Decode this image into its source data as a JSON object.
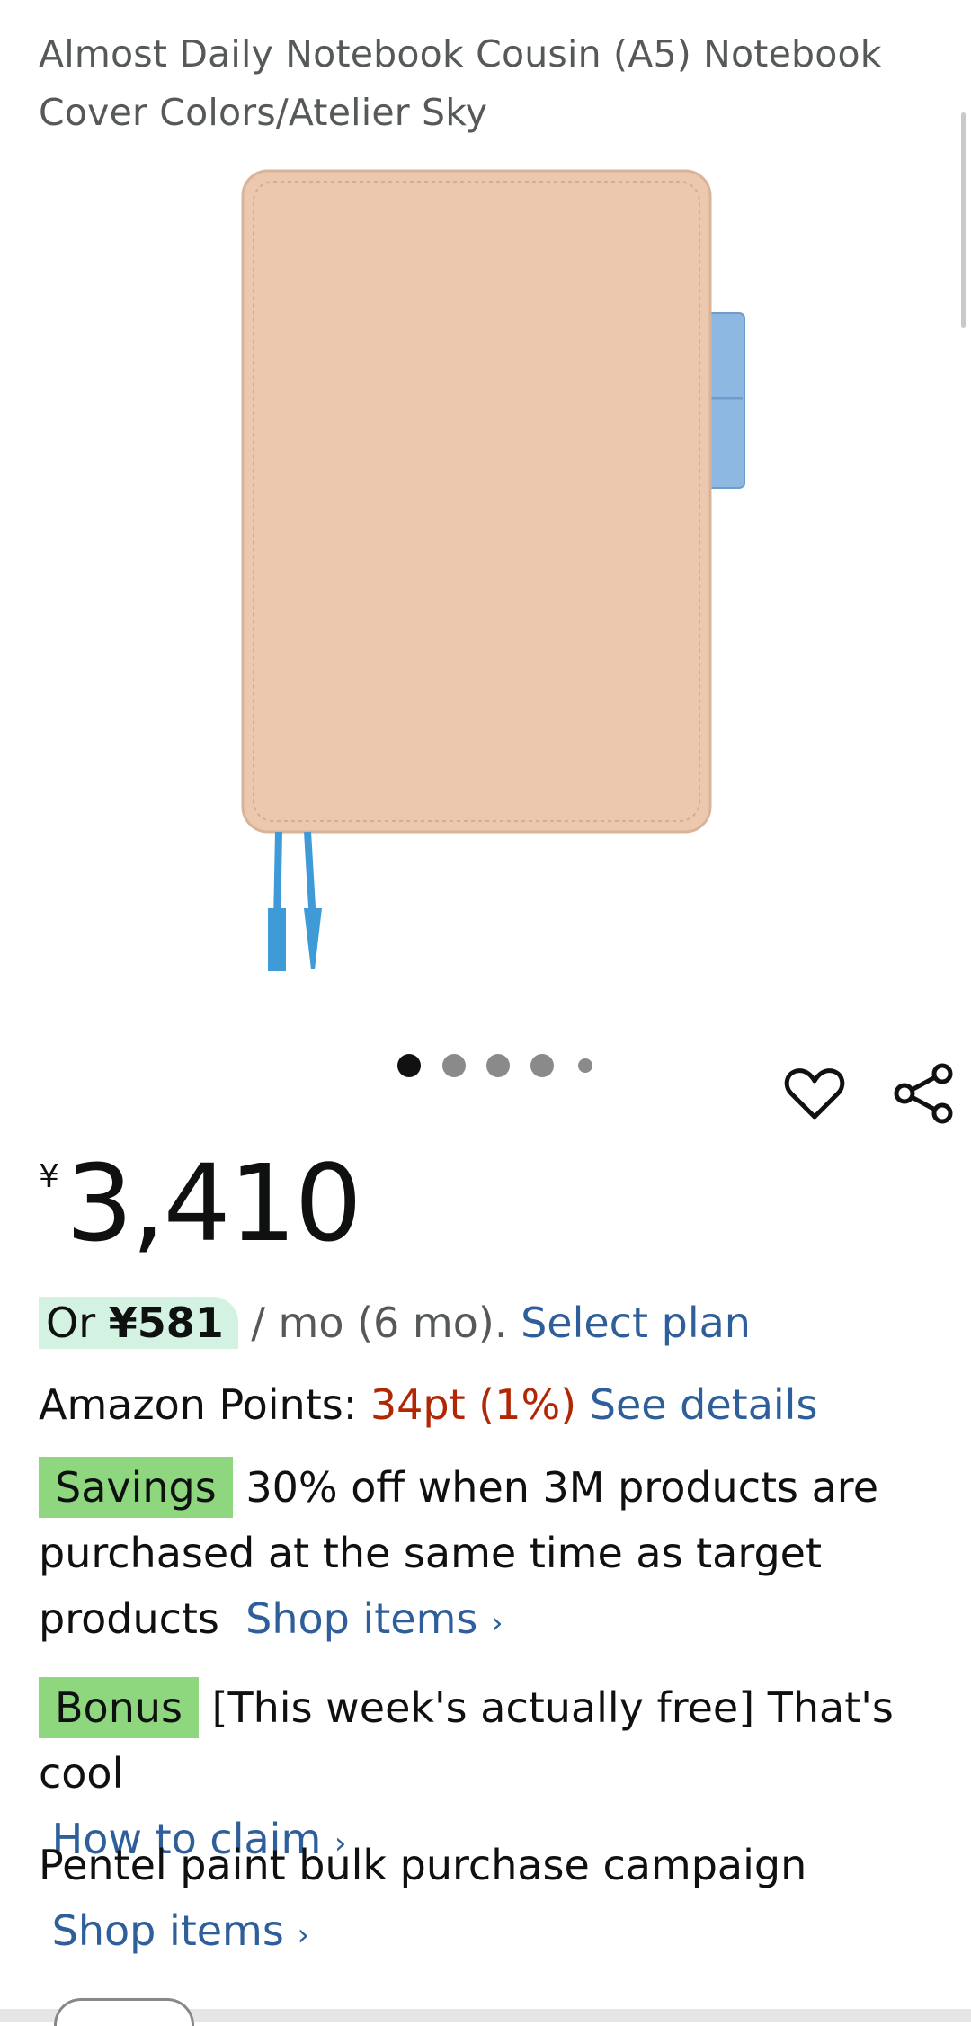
{
  "product": {
    "title": "Almost Daily Notebook Cousin (A5) Notebook Cover Colors/Atelier Sky",
    "colors": {
      "cover": "#ecc8ae",
      "accent_tab": "#8cb8e2",
      "bookmark": "#3f9ad8"
    }
  },
  "carousel": {
    "total": 5,
    "active_index": 0
  },
  "price": {
    "currency": "¥",
    "value": "3,410"
  },
  "installment": {
    "prefix": "Or",
    "amount": "¥581",
    "suffix": "/ mo (6 mo).",
    "link": "Select plan"
  },
  "points": {
    "label": "Amazon Points:",
    "value": "34pt",
    "percent": "(1%)",
    "link": "See details"
  },
  "savings": {
    "tag": "Savings",
    "text": "30% off when 3M products are purchased at the same time as target products",
    "link": "Shop items"
  },
  "bonus": {
    "tag": "Bonus",
    "text": "[This week's actually free] That's cool",
    "link": "How to claim"
  },
  "campaign": {
    "text": "Pentel paint bulk purchase campaign",
    "link": "Shop items"
  },
  "icons": {
    "wishlist": "heart-icon",
    "share": "share-icon",
    "chevron": "chevron-right-icon"
  }
}
